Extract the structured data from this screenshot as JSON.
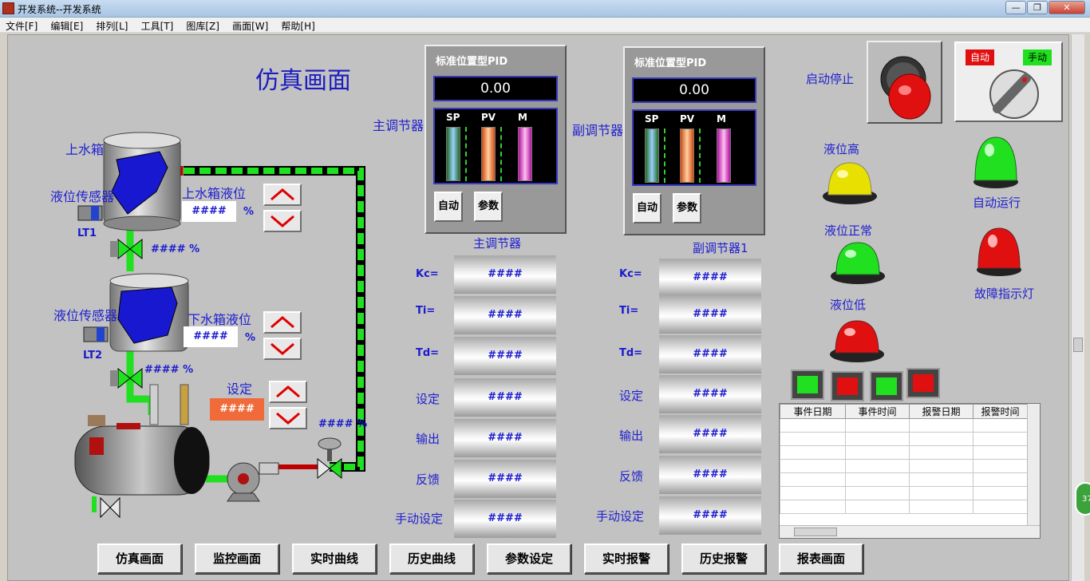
{
  "window": {
    "title": "开发系统--开发系统",
    "min": "—",
    "max": "❐",
    "close": "✕"
  },
  "menu": [
    "文件[F]",
    "编辑[E]",
    "排列[L]",
    "工具[T]",
    "图库[Z]",
    "画面[W]",
    "帮助[H]"
  ],
  "page": {
    "title": "仿真画面"
  },
  "process": {
    "upper_tank_label": "上水箱",
    "sensor1_label": "液位传感器",
    "lt1": "LT1",
    "upper_level_label": "上水箱液位",
    "upper_level_value": "####",
    "upper_level_unit": "%",
    "valve1_value": "#### %",
    "sensor2_label": "液位传感器",
    "lt2": "LT2",
    "lower_level_label": "下水箱液位",
    "lower_level_value": "####",
    "lower_level_unit": "%",
    "valve2_value": "####  %",
    "setpoint_label": "设定",
    "setpoint_value": "####",
    "pump_valve_value": "#### %"
  },
  "pid_main": {
    "title": "标准位置型PID",
    "display": "0.00",
    "bars": [
      "SP",
      "PV",
      "M"
    ],
    "auto": "自动",
    "params": "参数",
    "side_label": "主调节器"
  },
  "pid_sub": {
    "title": "标准位置型PID",
    "display": "0.00",
    "bars": [
      "SP",
      "PV",
      "M"
    ],
    "auto": "自动",
    "params": "参数",
    "side_label": "副调节器1"
  },
  "main_params": {
    "heading": "主调节器",
    "rows": [
      {
        "label": "Kc=",
        "value": "####"
      },
      {
        "label": "Ti=",
        "value": "####"
      },
      {
        "label": "Td=",
        "value": "####"
      },
      {
        "label": "设定",
        "value": "####"
      },
      {
        "label": "输出",
        "value": "####"
      },
      {
        "label": "反馈",
        "value": "####"
      },
      {
        "label": "手动设定",
        "value": "####"
      }
    ]
  },
  "sub_params": {
    "heading": "副调节器1",
    "rows": [
      {
        "label": "Kc=",
        "value": "####"
      },
      {
        "label": "Ti=",
        "value": "####"
      },
      {
        "label": "Td=",
        "value": "####"
      },
      {
        "label": "设定",
        "value": "####"
      },
      {
        "label": "输出",
        "value": "####"
      },
      {
        "label": "反馈",
        "value": "####"
      },
      {
        "label": "手动设定",
        "value": "####"
      }
    ]
  },
  "controls": {
    "start_stop": "启动停止",
    "auto": "自动",
    "manual": "手动"
  },
  "indicators": {
    "level_high": "液位高",
    "level_normal": "液位正常",
    "level_low": "液位低",
    "auto_run": "自动运行",
    "fault": "故障指示灯"
  },
  "alarm_table": {
    "columns": [
      "事件日期",
      "事件时间",
      "报警日期",
      "报警时间"
    ]
  },
  "nav": [
    "仿真画面",
    "监控画面",
    "实时曲线",
    "历史曲线",
    "参数设定",
    "实时报警",
    "历史报警",
    "报表画面"
  ],
  "badge": "37"
}
